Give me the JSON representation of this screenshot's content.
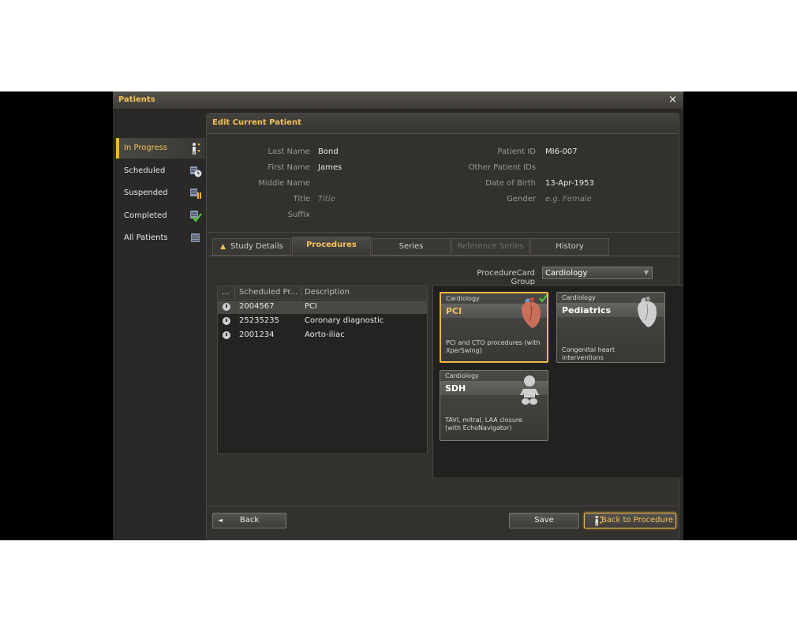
{
  "window": {
    "title": "Patients",
    "close": "×"
  },
  "nav": {
    "items": [
      {
        "label": "In Progress",
        "icon": "in-progress-person-icon"
      },
      {
        "label": "Scheduled",
        "icon": "scheduled-clock-icon"
      },
      {
        "label": "Suspended",
        "icon": "suspended-pause-icon"
      },
      {
        "label": "Completed",
        "icon": "completed-check-icon"
      },
      {
        "label": "All Patients",
        "icon": "all-patients-list-icon"
      }
    ]
  },
  "panel": {
    "title": "Edit Current Patient"
  },
  "patient": {
    "last_name_label": "Last Name",
    "last_name": "Bond",
    "first_name_label": "First Name",
    "first_name": "James",
    "middle_name_label": "Middle Name",
    "middle_name": "",
    "title_label": "Title",
    "title_placeholder": "Title",
    "suffix_label": "Suffix",
    "suffix": "",
    "patient_id_label": "Patient ID",
    "patient_id": "MI6-007",
    "other_ids_label": "Other Patient IDs",
    "other_ids": "",
    "dob_label": "Date of Birth",
    "dob": "13-Apr-1953",
    "gender_label": "Gender",
    "gender_placeholder": "e.g. Female"
  },
  "tabs": [
    {
      "label": "Study Details",
      "state": "normal",
      "warning": "▲"
    },
    {
      "label": "Procedures",
      "state": "active"
    },
    {
      "label": "Series",
      "state": "normal"
    },
    {
      "label": "Reference Series",
      "state": "disabled"
    },
    {
      "label": "History",
      "state": "normal"
    }
  ],
  "card_group": {
    "label": "ProcedureCard Group",
    "value": "Cardiology",
    "arrow": "▼"
  },
  "procedures_table": {
    "headers": [
      "...",
      "Scheduled Pr...",
      "Description"
    ],
    "rows": [
      {
        "id": "2004567",
        "description": "PCI",
        "selected": true
      },
      {
        "id": "25235235",
        "description": "Coronary diagnostic",
        "selected": false
      },
      {
        "id": "2001234",
        "description": "Aorto-iliac",
        "selected": false
      }
    ]
  },
  "cards": [
    {
      "group": "Cardiology",
      "name": "PCI",
      "description": "PCI and CTO procedures (with XperSwing)",
      "icon": "heart-icon",
      "selected": true
    },
    {
      "group": "Cardiology",
      "name": "Pediatrics",
      "description": "Congenital heart interventions",
      "icon": "heart-icon",
      "selected": false
    },
    {
      "group": "Cardiology",
      "name": "SDH",
      "description": "TAVI, mitral, LAA closure (with EchoNavigator)",
      "icon": "baby-icon",
      "selected": false
    }
  ],
  "footer": {
    "back_label": "Back",
    "back_arrow": "◄",
    "save_label": "Save",
    "back_to_procedure_label": "Back to Procedure"
  },
  "colors": {
    "accent": "#f2b233",
    "check": "#4cd137",
    "background": "#2a2927"
  }
}
